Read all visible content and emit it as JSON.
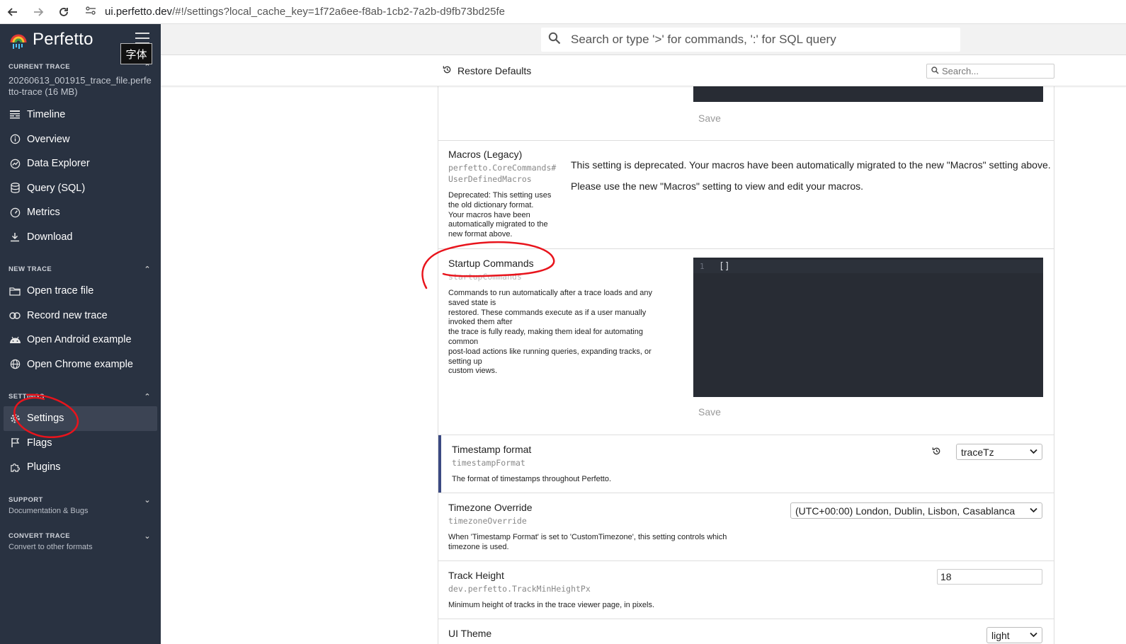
{
  "browser": {
    "url_host": "ui.perfetto.dev",
    "url_path": "/#!/settings?local_cache_key=1f72a6ee-f8ab-1cb2-7a2b-d9fb73bd25fe"
  },
  "app": {
    "name": "Perfetto",
    "tooltip": "字体"
  },
  "sidebar": {
    "current_trace": {
      "header": "CURRENT TRACE",
      "trace_name": "20260613_001915_trace_file.perfetto-trace (16 MB)",
      "items": [
        {
          "label": "Timeline",
          "icon": "timeline-icon"
        },
        {
          "label": "Overview",
          "icon": "info-icon"
        },
        {
          "label": "Data Explorer",
          "icon": "explore-icon"
        },
        {
          "label": "Query (SQL)",
          "icon": "database-icon"
        },
        {
          "label": "Metrics",
          "icon": "speed-icon"
        },
        {
          "label": "Download",
          "icon": "download-icon"
        }
      ]
    },
    "new_trace": {
      "header": "NEW TRACE",
      "items": [
        {
          "label": "Open trace file",
          "icon": "folder-icon"
        },
        {
          "label": "Record new trace",
          "icon": "record-icon"
        },
        {
          "label": "Open Android example",
          "icon": "android-icon"
        },
        {
          "label": "Open Chrome example",
          "icon": "globe-icon"
        }
      ]
    },
    "settings": {
      "header": "SETTINGS",
      "items": [
        {
          "label": "Settings",
          "icon": "gear-icon",
          "active": true
        },
        {
          "label": "Flags",
          "icon": "flag-icon"
        },
        {
          "label": "Plugins",
          "icon": "puzzle-icon"
        }
      ]
    },
    "support": {
      "header": "SUPPORT",
      "subtitle": "Documentation & Bugs"
    },
    "convert_trace": {
      "header": "CONVERT TRACE",
      "subtitle": "Convert to other formats"
    }
  },
  "omnibox": {
    "placeholder": "Search or type '>' for commands, ':' for SQL query"
  },
  "toolbar": {
    "restore_label": "Restore Defaults",
    "search_placeholder": "Search..."
  },
  "settings": {
    "top_save": "Save",
    "macros_legacy": {
      "title": "Macros (Legacy)",
      "key_line1": "perfetto.CoreCommands#",
      "key_line2": "UserDefinedMacros",
      "description": [
        "Deprecated: This setting uses",
        "the old dictionary format.",
        "Your macros have been",
        "automatically migrated to the",
        "new format above."
      ],
      "message1": "This setting is deprecated. Your macros have been automatically migrated to the new \"Macros\" setting above.",
      "message2": "Please use the new \"Macros\" setting to view and edit your macros."
    },
    "startup_commands": {
      "title": "Startup Commands",
      "key": "startupCommands",
      "description": [
        "Commands to run automatically after a trace loads and any",
        "saved state is",
        "restored. These commands execute as if a user manually",
        "invoked them after",
        "the trace is fully ready, making them ideal for automating",
        "common",
        "post-load actions like running queries, expanding tracks, or",
        "setting up",
        "custom views."
      ],
      "editor_line_number": "1",
      "editor_code": "[]",
      "save": "Save"
    },
    "timestamp_format": {
      "title": "Timestamp format",
      "key": "timestampFormat",
      "description": "The format of timestamps throughout Perfetto.",
      "value": "traceTz"
    },
    "timezone_override": {
      "title": "Timezone Override",
      "key": "timezoneOverride",
      "description_line1": "When 'Timestamp Format' is set to 'CustomTimezone', this setting controls which",
      "description_line2": "timezone is used.",
      "value": "(UTC+00:00) London, Dublin, Lisbon, Casablanca"
    },
    "track_height": {
      "title": "Track Height",
      "key": "dev.perfetto.TrackMinHeightPx",
      "description": "Minimum height of tracks in the trace viewer page, in pixels.",
      "value": "18"
    },
    "ui_theme": {
      "title": "UI Theme",
      "value": "light"
    }
  },
  "colors": {
    "sidebar_bg": "#293241",
    "editor_bg": "#282c34",
    "annotation_red": "#e8141c",
    "modified_accent": "#3b4a82"
  }
}
